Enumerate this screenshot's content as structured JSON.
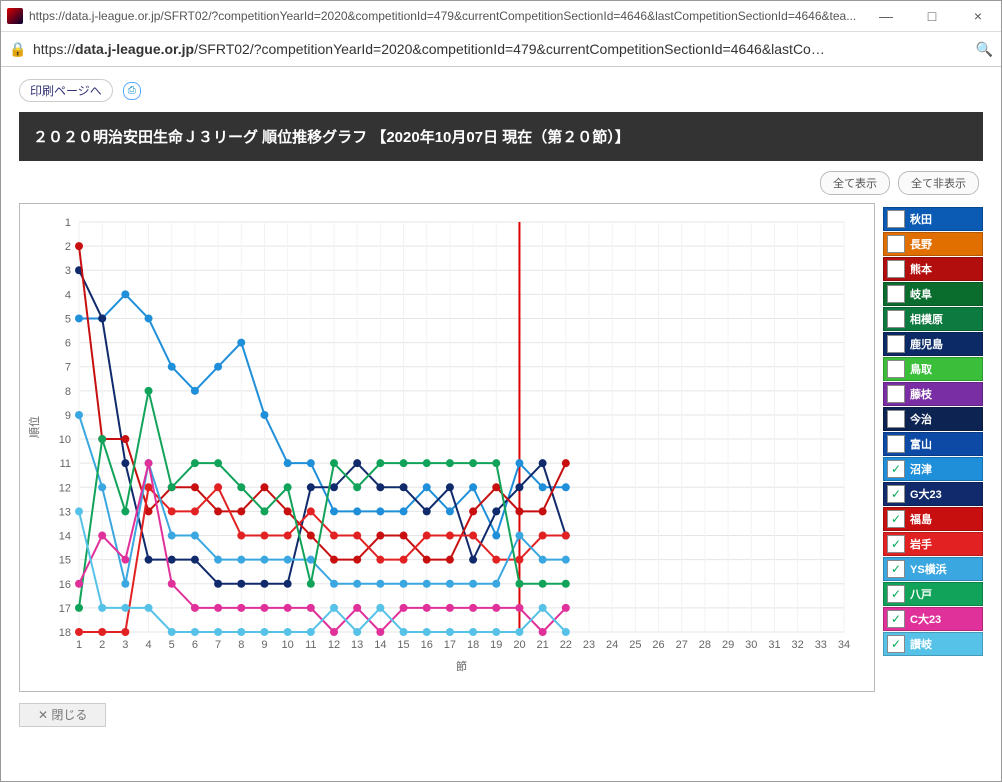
{
  "window": {
    "title": "https://data.j-league.or.jp/SFRT02/?competitionYearId=2020&competitionId=479&currentCompetitionSectionId=4646&lastCompetitionSectionId=4646&tea...",
    "min": "—",
    "max": "□",
    "close": "×"
  },
  "addr": {
    "lock": "🔒",
    "pre": "https://",
    "host": "data.j-league.or.jp",
    "rest": "/SFRT02/?competitionYearId=2020&competitionId=479&currentCompetitionSectionId=4646&lastCo…",
    "search": "🔍"
  },
  "toplinks": {
    "print": "印刷ページへ",
    "print_icon": "⎙"
  },
  "title": "２０２０明治安田生命Ｊ３リーグ 順位推移グラフ 【2020年10月07日 現在（第２０節）】",
  "buttons": {
    "show_all": "全て表示",
    "hide_all": "全て非表示"
  },
  "axis": {
    "y": "順位",
    "x": "節"
  },
  "close_btn": "✕ 閉じる",
  "legend": [
    {
      "name": "秋田",
      "color": "#0b5bb5",
      "checked": false
    },
    {
      "name": "長野",
      "color": "#e06f00",
      "checked": false
    },
    {
      "name": "熊本",
      "color": "#b20e0e",
      "checked": false
    },
    {
      "name": "岐阜",
      "color": "#0a6d2e",
      "checked": false
    },
    {
      "name": "相模原",
      "color": "#0d7a40",
      "checked": false
    },
    {
      "name": "鹿児島",
      "color": "#0b2a66",
      "checked": false
    },
    {
      "name": "鳥取",
      "color": "#3bbf3b",
      "checked": false
    },
    {
      "name": "藤枝",
      "color": "#7a2ea3",
      "checked": false
    },
    {
      "name": "今治",
      "color": "#0d2452",
      "checked": false
    },
    {
      "name": "富山",
      "color": "#0c4aa6",
      "checked": false
    },
    {
      "name": "沼津",
      "color": "#1f8fd9",
      "checked": true
    },
    {
      "name": "G大23",
      "color": "#102a6b",
      "checked": true
    },
    {
      "name": "福島",
      "color": "#c70f0f",
      "checked": true
    },
    {
      "name": "岩手",
      "color": "#e22222",
      "checked": true
    },
    {
      "name": "YS横浜",
      "color": "#3aa7e0",
      "checked": true
    },
    {
      "name": "八戸",
      "color": "#12a35a",
      "checked": true
    },
    {
      "name": "C大23",
      "color": "#e0319a",
      "checked": true
    },
    {
      "name": "讃岐",
      "color": "#57c2e8",
      "checked": true
    }
  ],
  "chart_data": {
    "type": "line",
    "title": "２０２０明治安田生命Ｊ３リーグ 順位推移グラフ",
    "xlabel": "節",
    "ylabel": "順位",
    "xlim": [
      1,
      34
    ],
    "ylim": [
      18,
      1
    ],
    "current_round": 20,
    "x": [
      1,
      2,
      3,
      4,
      5,
      6,
      7,
      8,
      9,
      10,
      11,
      12,
      13,
      14,
      15,
      16,
      17,
      18,
      19,
      20,
      21,
      22
    ],
    "series": [
      {
        "name": "沼津",
        "color": "#1f8fd9",
        "values": [
          5,
          5,
          4,
          5,
          7,
          8,
          7,
          6,
          9,
          11,
          11,
          13,
          13,
          13,
          13,
          12,
          13,
          12,
          14,
          11,
          12,
          12
        ]
      },
      {
        "name": "G大23",
        "color": "#102a6b",
        "values": [
          3,
          5,
          11,
          15,
          15,
          15,
          16,
          16,
          16,
          16,
          12,
          12,
          11,
          12,
          12,
          13,
          12,
          15,
          13,
          12,
          11,
          14
        ]
      },
      {
        "name": "福島",
        "color": "#c70f0f",
        "values": [
          2,
          10,
          10,
          13,
          12,
          12,
          13,
          13,
          12,
          13,
          14,
          15,
          15,
          14,
          14,
          15,
          15,
          13,
          12,
          13,
          13,
          11
        ]
      },
      {
        "name": "岩手",
        "color": "#e22222",
        "values": [
          18,
          18,
          18,
          12,
          13,
          13,
          12,
          14,
          14,
          14,
          13,
          14,
          14,
          15,
          15,
          14,
          14,
          14,
          15,
          15,
          14,
          14
        ]
      },
      {
        "name": "YS横浜",
        "color": "#3aa7e0",
        "values": [
          9,
          12,
          16,
          11,
          14,
          14,
          15,
          15,
          15,
          15,
          15,
          16,
          16,
          16,
          16,
          16,
          16,
          16,
          16,
          14,
          15,
          15
        ]
      },
      {
        "name": "八戸",
        "color": "#12a35a",
        "values": [
          17,
          10,
          13,
          8,
          12,
          11,
          11,
          12,
          13,
          12,
          16,
          11,
          12,
          11,
          11,
          11,
          11,
          11,
          11,
          16,
          16,
          16
        ]
      },
      {
        "name": "C大23",
        "color": "#e0319a",
        "values": [
          16,
          14,
          15,
          11,
          16,
          17,
          17,
          17,
          17,
          17,
          17,
          18,
          17,
          18,
          17,
          17,
          17,
          17,
          17,
          17,
          18,
          17
        ]
      },
      {
        "name": "讃岐",
        "color": "#57c2e8",
        "values": [
          13,
          17,
          17,
          17,
          18,
          18,
          18,
          18,
          18,
          18,
          18,
          17,
          18,
          17,
          18,
          18,
          18,
          18,
          18,
          18,
          17,
          18
        ]
      }
    ]
  }
}
